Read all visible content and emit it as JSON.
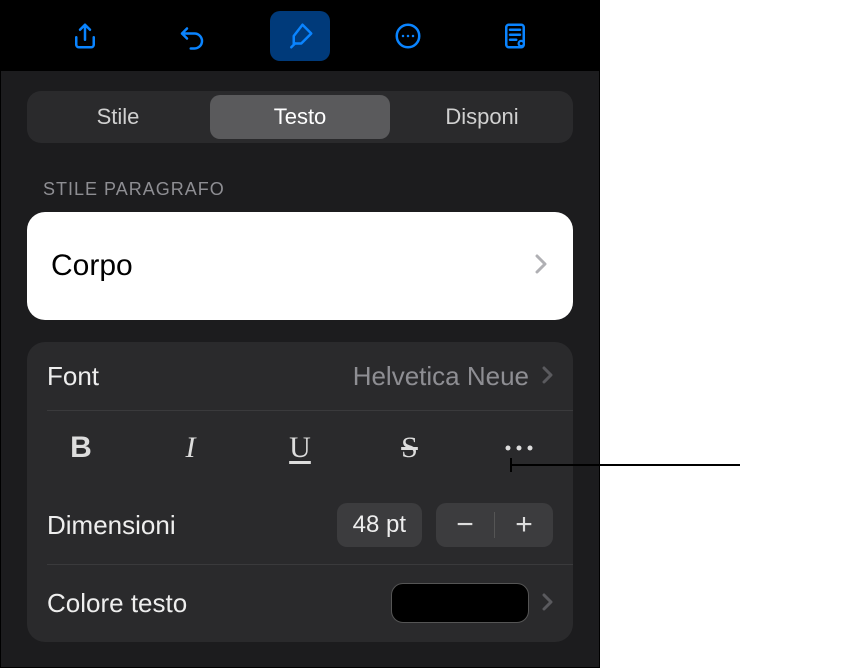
{
  "toolbar_icons": {
    "share": "share-icon",
    "undo": "undo-icon",
    "format": "format-brush-icon",
    "more": "ellipsis-circle-icon",
    "doc": "document-view-icon"
  },
  "segments": {
    "style": "Stile",
    "text": "Testo",
    "arrange": "Disponi"
  },
  "section": {
    "paragraph_style_label": "Stile paragrafo"
  },
  "paragraph_style": {
    "current": "Corpo"
  },
  "font_row": {
    "label": "Font",
    "value": "Helvetica Neue"
  },
  "format_buttons": {
    "bold": "B",
    "italic": "I",
    "underline": "U",
    "strike": "S"
  },
  "size_row": {
    "label": "Dimensioni",
    "value": "48 pt",
    "minus": "−",
    "plus": "+"
  },
  "textcolor_row": {
    "label": "Colore testo",
    "swatch_color": "#000000"
  }
}
